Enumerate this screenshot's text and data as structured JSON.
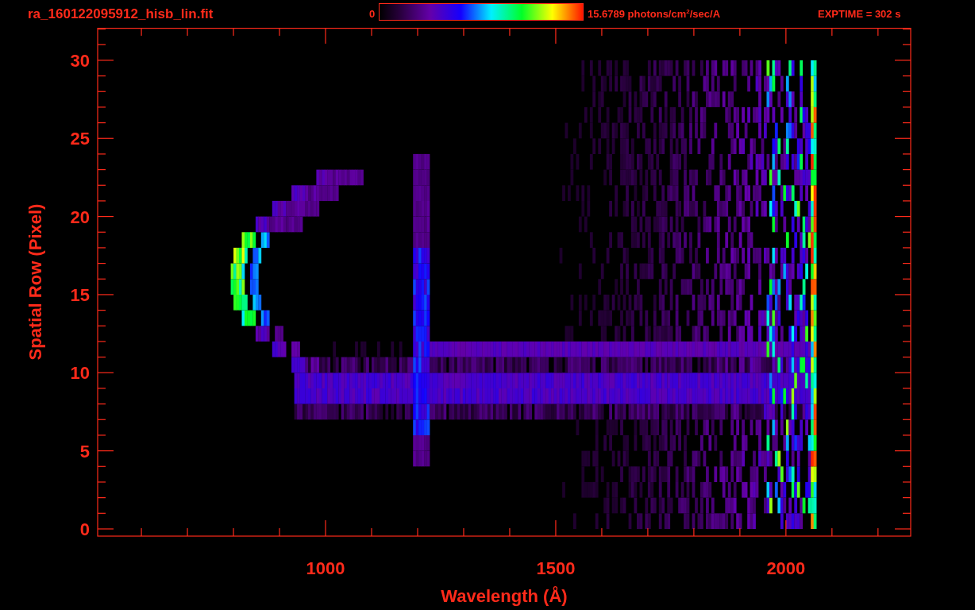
{
  "header": {
    "title": "ra_160122095912_hisb_lin.fit",
    "colorbar": {
      "min_label": "0",
      "max_label": "15.6789 photons/cm$^{2}$/sec/A"
    },
    "exposure": "EXPTIME = 302 s"
  },
  "plot": {
    "xlabel": "Wavelength (Å)",
    "ylabel": "Spatial Row (Pixel)",
    "xticks": [
      "1000",
      "1500",
      "2000"
    ],
    "yticks": [
      "30",
      "25",
      "20",
      "15",
      "10",
      "5",
      "0"
    ]
  }
}
